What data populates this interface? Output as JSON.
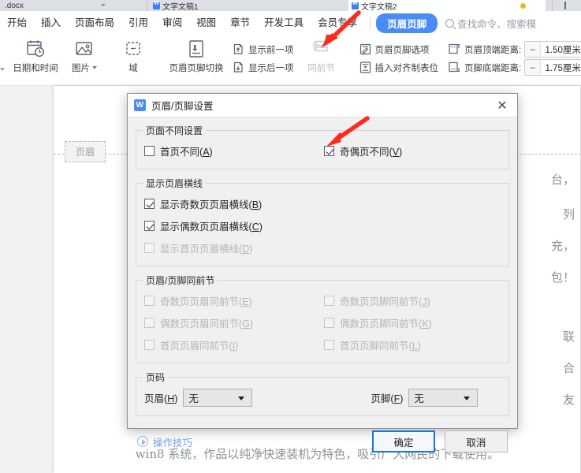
{
  "window": {
    "tabs": [
      {
        "label": ".docx",
        "icon": "document-tab-icon",
        "active": false
      },
      {
        "label": "文字文稿1",
        "icon": "wps-writer-icon",
        "active": false
      },
      {
        "label": "文字文稿2",
        "icon": "wps-writer-icon",
        "active": true
      }
    ]
  },
  "ribbon": {
    "tabs": [
      {
        "label": "开始"
      },
      {
        "label": "插入"
      },
      {
        "label": "页面布局"
      },
      {
        "label": "引用"
      },
      {
        "label": "审阅"
      },
      {
        "label": "视图"
      },
      {
        "label": "章节"
      },
      {
        "label": "开发工具"
      },
      {
        "label": "会员专享"
      }
    ],
    "context_tab": "页眉页脚",
    "search_placeholder": "查找命令、搜索模",
    "groups": {
      "insert": [
        {
          "label": "日期和时间",
          "icon": "calendar-clock-icon"
        },
        {
          "label": "图片",
          "icon": "picture-icon",
          "dropdown": true
        },
        {
          "label": "域",
          "icon": "field-icon"
        }
      ],
      "navigate_big": {
        "label": "页眉页脚切换",
        "icon": "header-footer-switch-icon"
      },
      "navigate_small": [
        {
          "label": "显示前一项",
          "icon": "show-previous-icon"
        },
        {
          "label": "显示后一项",
          "icon": "show-next-icon"
        }
      ],
      "link_prev": {
        "label": "同前节",
        "icon": "link-to-previous-icon",
        "disabled": true
      },
      "options_small": [
        {
          "label": "页眉页脚选项",
          "icon": "header-footer-options-icon"
        },
        {
          "label": "插入对齐制表位",
          "icon": "insert-align-tab-icon"
        }
      ],
      "measurements": [
        {
          "label": "页眉顶端距离:",
          "value": "1.50厘米",
          "icon": "header-top-distance-icon",
          "minus": "−",
          "plus": "+"
        },
        {
          "label": "页脚底端距离:",
          "value": "1.75厘米",
          "icon": "footer-bottom-distance-icon",
          "minus": "−",
          "plus": "+"
        }
      ]
    }
  },
  "document": {
    "header_tag": "页眉",
    "right_fragments": [
      "台，",
      "列",
      "充，",
      "包！",
      "联",
      "合",
      "友"
    ],
    "bottom_line": "win8 系统，作品以纯净快速装机为特色，吸引广大网民的下载使用。"
  },
  "dialog": {
    "title": "页眉/页脚设置",
    "close": "✕",
    "groups": [
      {
        "legend": "页面不同设置",
        "name": "page-difference-settings",
        "items": [
          {
            "label": "首页不同(A)",
            "mnemonic": "A",
            "text": "首页不同",
            "checked": false,
            "disabled": false
          },
          {
            "label": "奇偶页不同(V)",
            "mnemonic": "V",
            "text": "奇偶页不同",
            "checked": true,
            "disabled": false
          }
        ]
      },
      {
        "legend": "显示页眉横线",
        "name": "show-header-rule",
        "items": [
          {
            "label": "显示奇数页页眉横线(B)",
            "mnemonic": "B",
            "text": "显示奇数页页眉横线",
            "checked": true,
            "disabled": false
          },
          {
            "label": "显示偶数页页眉横线(C)",
            "mnemonic": "C",
            "text": "显示偶数页页眉横线",
            "checked": true,
            "disabled": false
          },
          {
            "label": "显示首页页眉横线(D)",
            "mnemonic": "D",
            "text": "显示首页页眉横线",
            "checked": false,
            "disabled": true
          }
        ]
      },
      {
        "legend": "页眉/页脚同前节",
        "name": "same-as-previous-section",
        "items": [
          {
            "label": "奇数页页眉同前节(E)",
            "mnemonic": "E",
            "text": "奇数页页眉同前节",
            "checked": false,
            "disabled": true
          },
          {
            "label": "奇数页页脚同前节(J)",
            "mnemonic": "J",
            "text": "奇数页页脚同前节",
            "checked": false,
            "disabled": true
          },
          {
            "label": "偶数页页眉同前节(G)",
            "mnemonic": "G",
            "text": "偶数页页眉同前节",
            "checked": false,
            "disabled": true
          },
          {
            "label": "偶数页页脚同前节(K)",
            "mnemonic": "K",
            "text": "偶数页页脚同前节",
            "checked": false,
            "disabled": true
          },
          {
            "label": "首页页眉同前节(I)",
            "mnemonic": "I",
            "text": "首页页眉同前节",
            "checked": false,
            "disabled": true
          },
          {
            "label": "首页页脚同前节(L)",
            "mnemonic": "L",
            "text": "首页页脚同前节",
            "checked": false,
            "disabled": true
          }
        ]
      }
    ],
    "page_number": {
      "legend": "页码",
      "header": {
        "label_text": "页眉",
        "mnemonic": "H",
        "value": "无"
      },
      "footer": {
        "label_text": "页脚",
        "mnemonic": "F",
        "value": "无"
      }
    },
    "footer": {
      "tip": "操作技巧",
      "ok": "确定",
      "cancel": "取消"
    }
  },
  "annotations": {
    "arrow_color": "#fb2c1e",
    "arrows": [
      {
        "name": "arrow-to-header-footer-options",
        "from": [
          452,
          18
        ],
        "to": [
          408,
          56
        ]
      },
      {
        "name": "arrow-to-odd-even-different",
        "from": [
          466,
          148
        ],
        "to": [
          414,
          180
        ]
      }
    ]
  },
  "colors": {
    "accent_blue": "#4a8cf7",
    "focus_blue": "#1878d2",
    "dialog_bg": "#f0f0f0",
    "canvas_bg": "#f2f2f2",
    "annotation_red": "#fb2c1e"
  }
}
